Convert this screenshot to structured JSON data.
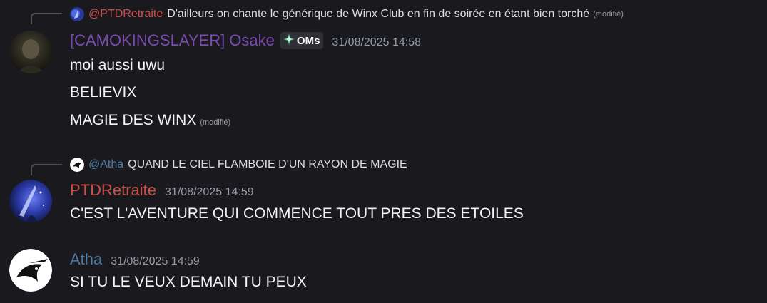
{
  "messages": [
    {
      "reply": {
        "author": "@PTDRetraite",
        "author_color": "#c9504a",
        "text": "D'ailleurs on chante le générique de Winx Club en fin de soirée en étant bien torché",
        "edited": "(modifié)"
      },
      "author": "[CAMOKINGSLAYER] Osake",
      "author_color": "#7a4cae",
      "badge": {
        "icon": "diamond-compass-icon",
        "label": "OMs"
      },
      "timestamp": "31/08/2025 14:58",
      "lines": [
        {
          "text": "moi aussi uwu"
        },
        {
          "text": "BELIEVIX"
        },
        {
          "text": "MAGIE DES WINX",
          "edited": "(modifié)"
        }
      ]
    },
    {
      "reply": {
        "author": "@Atha",
        "author_color": "#4f7ba3",
        "text": "QUAND LE CIEL FLAMBOIE D'UN RAYON DE MAGIE"
      },
      "author": "PTDRetraite",
      "author_color": "#c9504a",
      "timestamp": "31/08/2025 14:59",
      "lines": [
        {
          "text": "C'EST L'AVENTURE QUI COMMENCE TOUT PRES DES ETOILES"
        }
      ]
    },
    {
      "author": "Atha",
      "author_color": "#4f7ba3",
      "timestamp": "31/08/2025 14:59",
      "lines": [
        {
          "text": "SI TU LE VEUX DEMAIN TU PEUX"
        }
      ]
    }
  ]
}
